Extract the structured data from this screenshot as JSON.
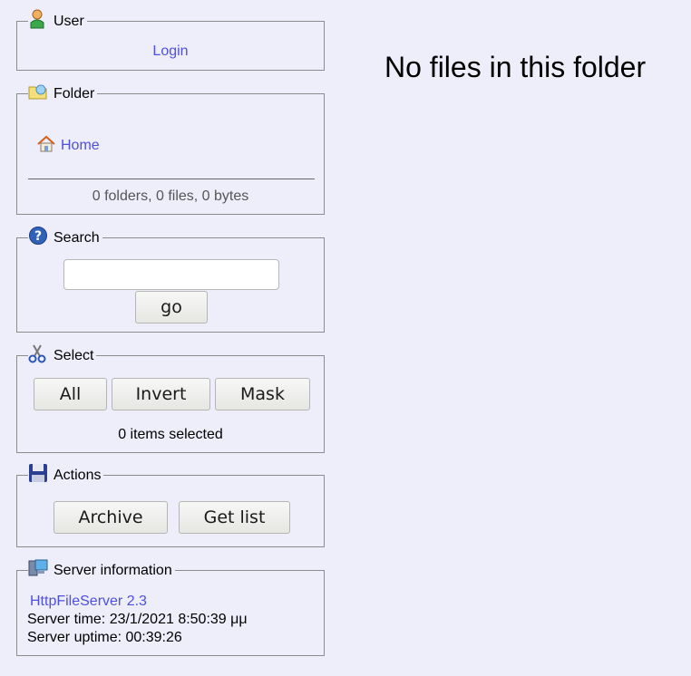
{
  "user": {
    "title": "User",
    "login_label": "Login"
  },
  "folder": {
    "title": "Folder",
    "home_label": "Home",
    "summary": "0 folders, 0 files, 0 bytes"
  },
  "search": {
    "title": "Search",
    "input_value": "",
    "go_label": "go"
  },
  "select": {
    "title": "Select",
    "all_label": "All",
    "invert_label": "Invert",
    "mask_label": "Mask",
    "status": "0 items selected"
  },
  "actions": {
    "title": "Actions",
    "archive_label": "Archive",
    "getlist_label": "Get list"
  },
  "server": {
    "title": "Server information",
    "software_link": "HttpFileServer 2.3",
    "time_line": "Server time: 23/1/2021 8:50:39 μμ",
    "uptime_line": "Server uptime: 00:39:26"
  },
  "main": {
    "empty_message": "No files in this folder"
  }
}
